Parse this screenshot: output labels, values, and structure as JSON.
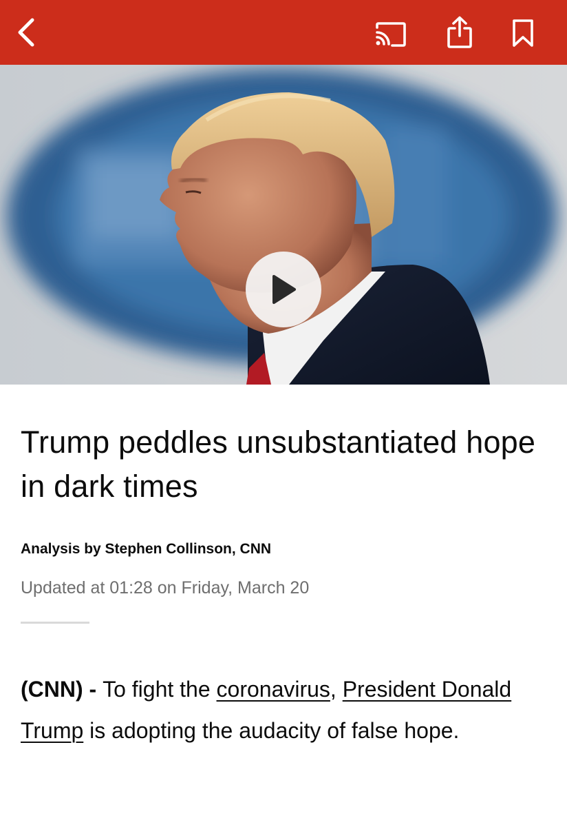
{
  "topbar": {
    "background": "#cc2d1b",
    "icons": [
      "chevron-left-icon",
      "cast-icon",
      "share-icon",
      "bookmark-icon"
    ]
  },
  "hero": {
    "media": "video",
    "overlay_icon": "play-icon"
  },
  "article": {
    "headline": "Trump peddles unsubstantiated hope in dark times",
    "byline": "Analysis by Stephen Collinson, CNN",
    "updated": "Updated at 01:28 on Friday, March 20",
    "lead": {
      "source": "(CNN)",
      "dash": " - ",
      "text_1": "To fight the ",
      "link_1": "coronavirus",
      "text_2": ", ",
      "link_2": "President Donald Trump",
      "text_3": " is adopting the audacity of false hope."
    }
  }
}
